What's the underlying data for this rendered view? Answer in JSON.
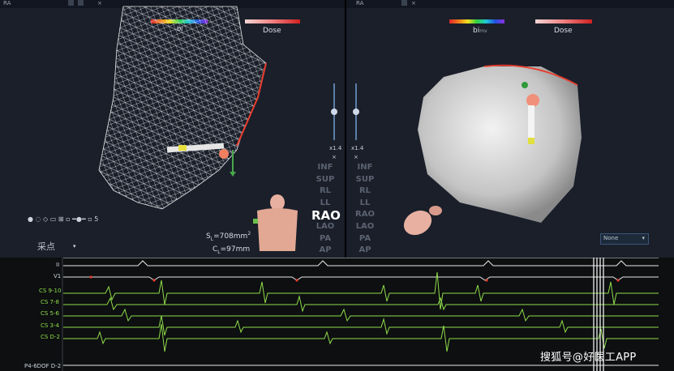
{
  "left_panel": {
    "tab_title": "RA",
    "colorbar_label": "bi",
    "dose_label": "Dose",
    "zoom": "x1.4",
    "close_symbol": "×",
    "sampling_label": "采点",
    "area_label": "S",
    "area_sub": "L",
    "area_value": "=708mm",
    "area_sup": "2",
    "circ_label": "C",
    "circ_sub": "L",
    "circ_value": "=97mm",
    "toolbar_value": "5"
  },
  "right_panel": {
    "tab_title": "RA",
    "colorbar_label": "bi",
    "colorbar_unit": "mv",
    "dose_label": "Dose",
    "zoom": "x1.4",
    "close_symbol": "×",
    "dropdown_value": "None"
  },
  "view_buttons": [
    "INF",
    "SUP",
    "RL",
    "LL",
    "RAO",
    "LAO",
    "PA",
    "AP"
  ],
  "active_view": "RAO",
  "scale_value": "200",
  "ecg_channels": [
    "II",
    "V1",
    "CS 9-10",
    "CS 7-8",
    "CS 5-6",
    "CS 3-4",
    "CS D-2",
    "P4-6DOF D-2"
  ],
  "watermark": "搜狐号@好医工APP",
  "colors": {
    "accent": "#5d7ea8",
    "ecg_green": "#8fdc4a",
    "mesh": "#e6e6e6",
    "border_red": "#e83c2c"
  }
}
